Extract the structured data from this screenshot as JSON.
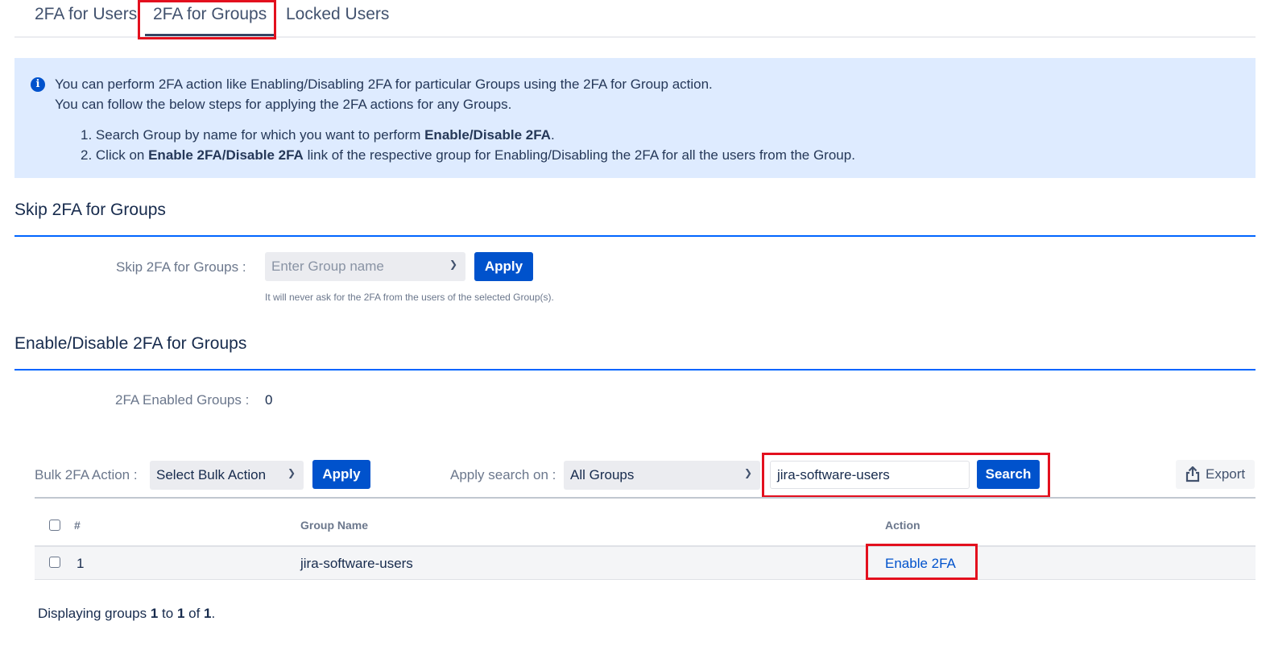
{
  "tabs": [
    {
      "label": "2FA for Users",
      "active": false
    },
    {
      "label": "2FA for Groups",
      "active": true
    },
    {
      "label": "Locked Users",
      "active": false
    }
  ],
  "info": {
    "line1": "You can perform 2FA action like Enabling/Disabling 2FA for particular Groups using the 2FA for Group action.",
    "line2": "You can follow the below steps for applying the 2FA actions for any Groups.",
    "step1_prefix": "1. Search Group by name for which you want to perform ",
    "step1_bold": "Enable/Disable 2FA",
    "step1_suffix": ".",
    "step2_prefix": "2. Click on ",
    "step2_bold": "Enable 2FA/Disable 2FA",
    "step2_suffix": " link of the respective group for Enabling/Disabling the 2FA for all the users from the Group.",
    "icon": "info-icon"
  },
  "skip_section": {
    "title": "Skip 2FA for Groups",
    "field_label": "Skip 2FA for Groups :",
    "select_placeholder": "Enter Group name",
    "apply_label": "Apply",
    "hint": "It will never ask for the 2FA from the users of the selected Group(s)."
  },
  "enable_section": {
    "title": "Enable/Disable 2FA for Groups",
    "enabled_label": "2FA Enabled Groups :",
    "enabled_count": "0"
  },
  "toolbar": {
    "bulk_label": "Bulk 2FA Action :",
    "bulk_select": "Select Bulk Action",
    "bulk_apply": "Apply",
    "search_on_label": "Apply search on :",
    "search_on_select": "All Groups",
    "search_value": "jira-software-users",
    "search_button": "Search",
    "export_label": "Export",
    "export_icon": "upload-icon"
  },
  "table": {
    "columns": [
      "#",
      "Group Name",
      "Action"
    ],
    "rows": [
      {
        "index": "1",
        "group_name": "jira-software-users",
        "action": "Enable 2FA"
      }
    ]
  },
  "footer": {
    "prefix": "Displaying groups ",
    "from": "1",
    "to_word": " to ",
    "to": "1",
    "of_word": " of ",
    "total": "1",
    "suffix": "."
  },
  "colors": {
    "primary": "#0052cc",
    "highlight_box": "#e3101e",
    "info_bg": "#deebff"
  }
}
